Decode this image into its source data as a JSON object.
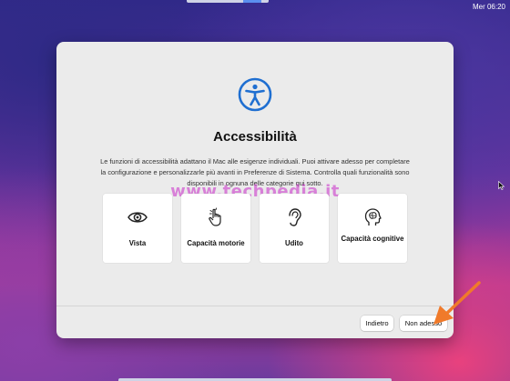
{
  "menubar": {
    "time": "Mer 06:20"
  },
  "dialog": {
    "icon": "accessibility-icon",
    "title": "Accessibilità",
    "description": "Le funzioni di accessibilità adattano il Mac alle esigenze individuali. Puoi attivare adesso per completare la configurazione e personalizzarle più avanti in Preferenze di Sistema. Controlla quali funzionalità sono disponibili in ognuna delle categorie qui sotto.",
    "watermark": "www.techpedia.it",
    "categories": [
      {
        "label": "Vista",
        "icon": "eye-icon"
      },
      {
        "label": "Capacità motorie",
        "icon": "hand-pointer-icon"
      },
      {
        "label": "Udito",
        "icon": "ear-icon"
      },
      {
        "label": "Capacità cognitive",
        "icon": "head-brain-icon"
      }
    ],
    "buttons": {
      "back": "Indietro",
      "not_now": "Non adesso"
    }
  },
  "colors": {
    "accent": "#1f6fd1",
    "annotation_arrow": "#f07a2a"
  }
}
